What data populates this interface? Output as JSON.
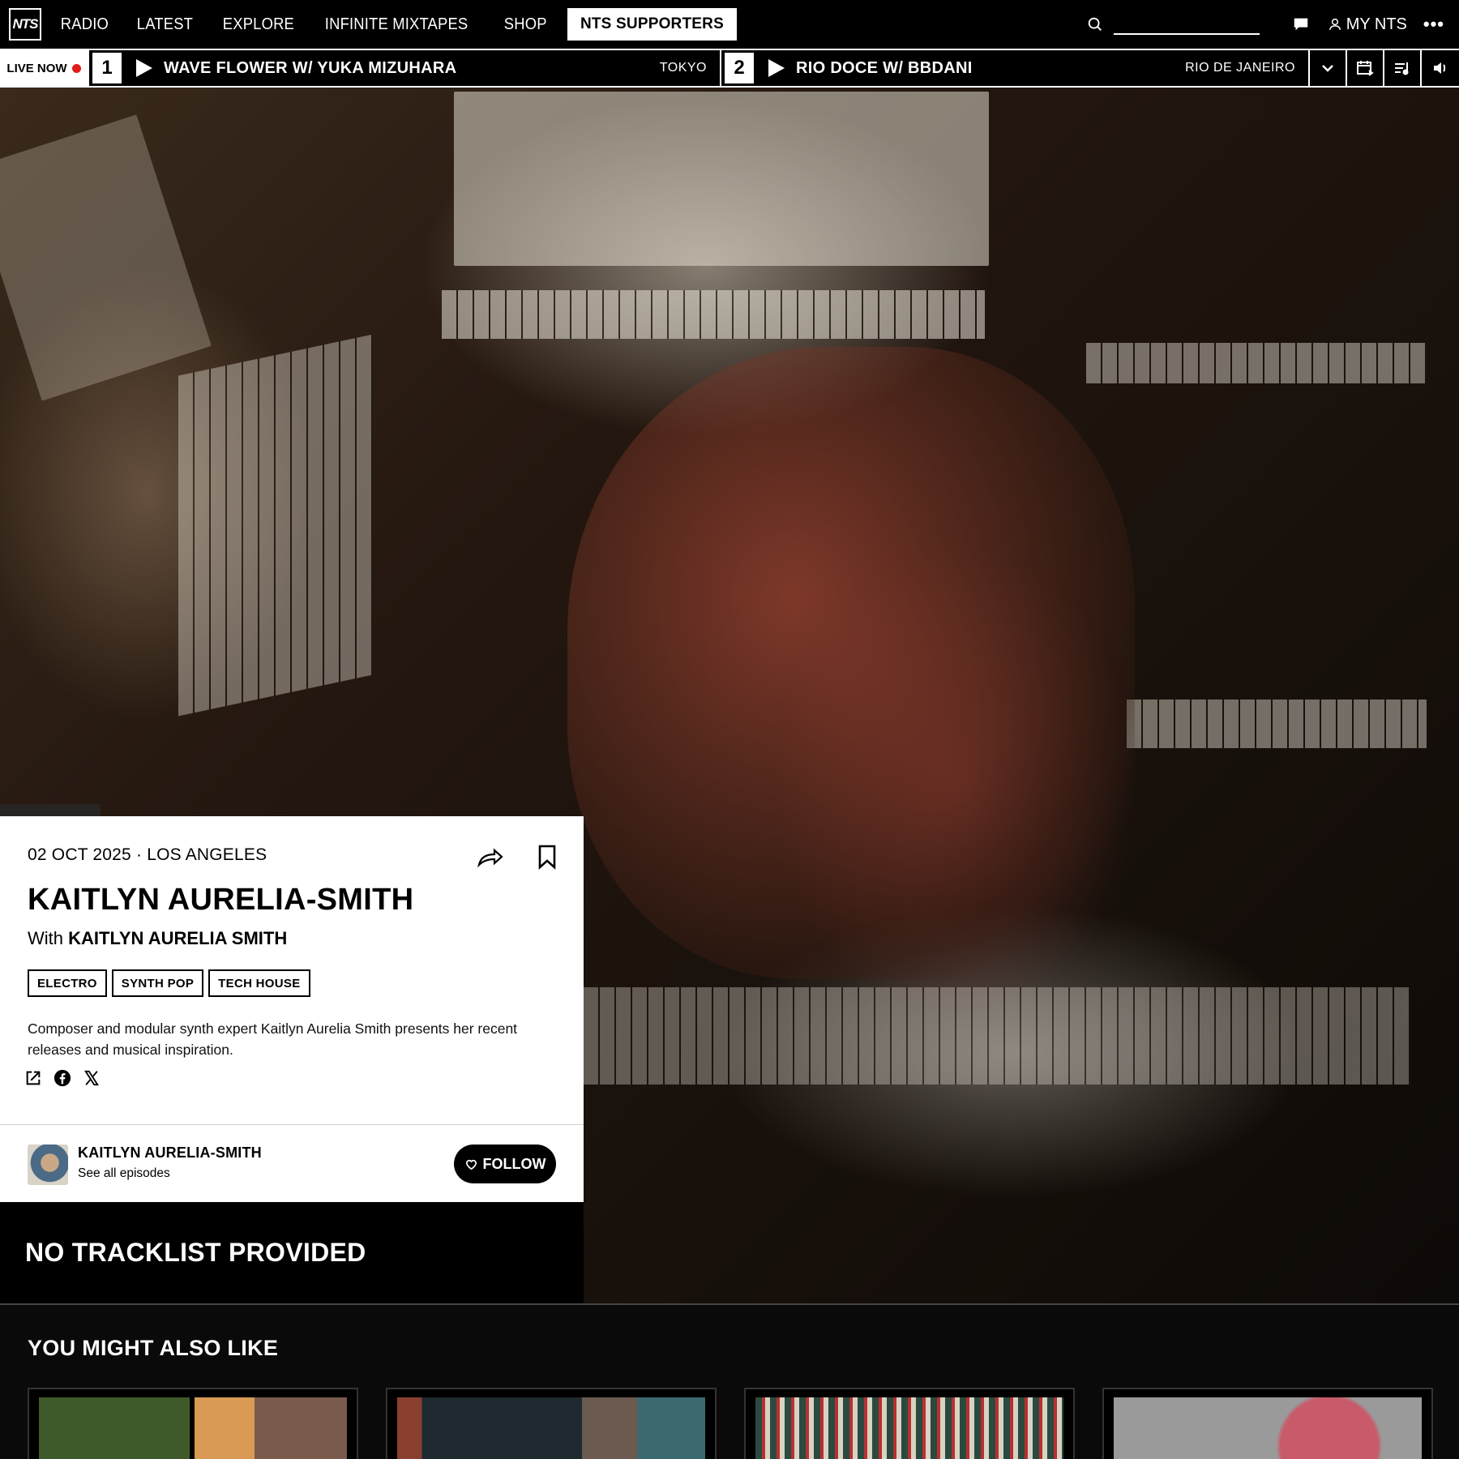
{
  "nav": {
    "logo": "NTS",
    "links": [
      "RADIO",
      "LATEST",
      "EXPLORE",
      "INFINITE MIXTAPES",
      "SHOP"
    ],
    "supporters": "NTS SUPPORTERS",
    "search_placeholder": "",
    "my_nts": "MY NTS",
    "more": "•••"
  },
  "live": {
    "label": "LIVE NOW",
    "channels": [
      {
        "number": "1",
        "title": "WAVE FLOWER W/ YUKA MIZUHARA",
        "location": "TOKYO"
      },
      {
        "number": "2",
        "title": "RIO DOCE W/ BBDANI",
        "location": "RIO DE JANEIRO"
      }
    ]
  },
  "episode": {
    "date": "02 OCT 2025",
    "separator": "·",
    "location": "LOS ANGELES",
    "title": "KAITLYN AURELIA-SMITH",
    "with_prefix": "With",
    "with_name": "KAITLYN AURELIA SMITH",
    "tags": [
      "ELECTRO",
      "SYNTH POP",
      "TECH HOUSE"
    ],
    "description": "Composer and modular synth expert Kaitlyn Aurelia Smith presents her recent releases and musical inspiration."
  },
  "host": {
    "name": "KAITLYN AURELIA-SMITH",
    "sub": "See all episodes",
    "follow": "FOLLOW"
  },
  "tracklist": {
    "title": "NO TRACKLIST PROVIDED"
  },
  "also_like": {
    "title": "YOU MIGHT ALSO LIKE"
  },
  "colors": {
    "accent_live": "#e21b1b",
    "bg": "#000000",
    "card": "#ffffff"
  }
}
